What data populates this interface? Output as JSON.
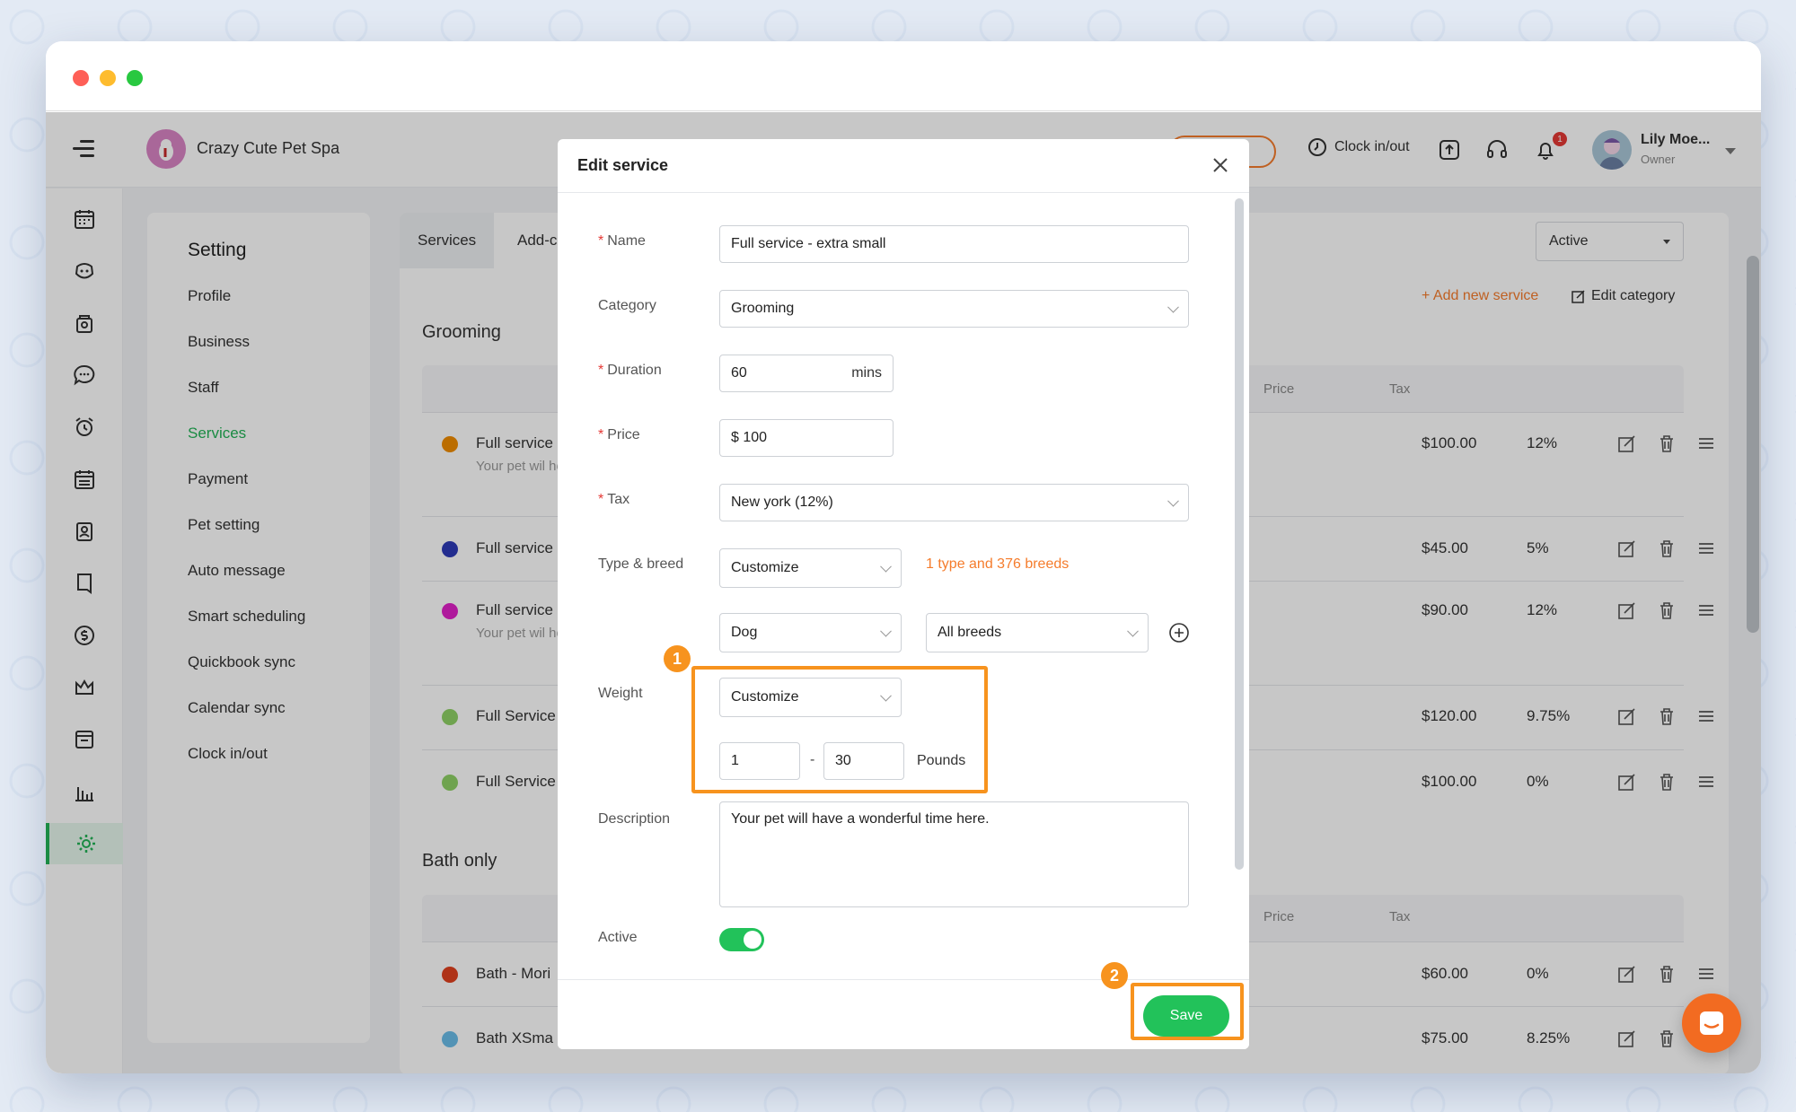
{
  "app": {
    "business_name": "Crazy Cute Pet Spa",
    "clock_label": "Clock in/out",
    "notification_count": "1",
    "user_name": "Lily Moe...",
    "user_role": "Owner"
  },
  "settings": {
    "title": "Setting",
    "items": [
      "Profile",
      "Business",
      "Staff",
      "Services",
      "Payment",
      "Pet setting",
      "Auto message",
      "Smart scheduling",
      "Quickbook sync",
      "Calendar sync",
      "Clock in/out"
    ],
    "active": "Services"
  },
  "main": {
    "tabs": [
      "Services",
      "Add-c"
    ],
    "status_filter": "Active",
    "add_service": "+ Add new service",
    "edit_category": "Edit category",
    "columns": {
      "price": "Price",
      "tax": "Tax"
    },
    "sections": [
      {
        "title": "Grooming",
        "rows": [
          {
            "name": "Full service",
            "desc": "Your pet wil here.",
            "price": "$100.00",
            "tax": "12%",
            "color": "#f08c00"
          },
          {
            "name": "Full service",
            "desc": "",
            "price": "$45.00",
            "tax": "5%",
            "color": "#2d3ab8"
          },
          {
            "name": "Full service",
            "desc": "Your pet wil here.",
            "price": "$90.00",
            "tax": "12%",
            "color": "#e020c8"
          },
          {
            "name": "Full Service",
            "desc": "",
            "price": "$120.00",
            "tax": "9.75%",
            "color": "#8fd166"
          },
          {
            "name": "Full Service",
            "desc": "",
            "price": "$100.00",
            "tax": "0%",
            "color": "#8fd166"
          }
        ]
      },
      {
        "title": "Bath only",
        "rows": [
          {
            "name": "Bath - Mori",
            "desc": "",
            "price": "$60.00",
            "tax": "0%",
            "color": "#e0401e"
          },
          {
            "name": "Bath XSma",
            "desc": "",
            "price": "$75.00",
            "tax": "8.25%",
            "color": "#6bbde8"
          }
        ]
      }
    ]
  },
  "modal": {
    "title": "Edit service",
    "labels": {
      "name": "Name",
      "category": "Category",
      "duration": "Duration",
      "price": "Price",
      "tax": "Tax",
      "type_breed": "Type & breed",
      "weight": "Weight",
      "description": "Description",
      "active": "Active"
    },
    "required_mark": "*",
    "values": {
      "name": "Full service - extra small",
      "category": "Grooming",
      "duration": "60",
      "duration_unit": "mins",
      "price": "$ 100",
      "tax": "New york (12%)",
      "type_breed_mode": "Customize",
      "breeds_summary": "1 type and 376 breeds",
      "pet_type": "Dog",
      "breeds": "All breeds",
      "weight_mode": "Customize",
      "weight_min": "1",
      "weight_sep": "-",
      "weight_max": "30",
      "weight_unit": "Pounds",
      "description": "Your pet will have a wonderful time here.",
      "active": true
    },
    "save_label": "Save"
  },
  "annotations": {
    "step1": "1",
    "step2": "2"
  },
  "colors": {
    "accent": "#22c25a",
    "brand": "#f57c2c",
    "highlight": "#f7931e"
  }
}
